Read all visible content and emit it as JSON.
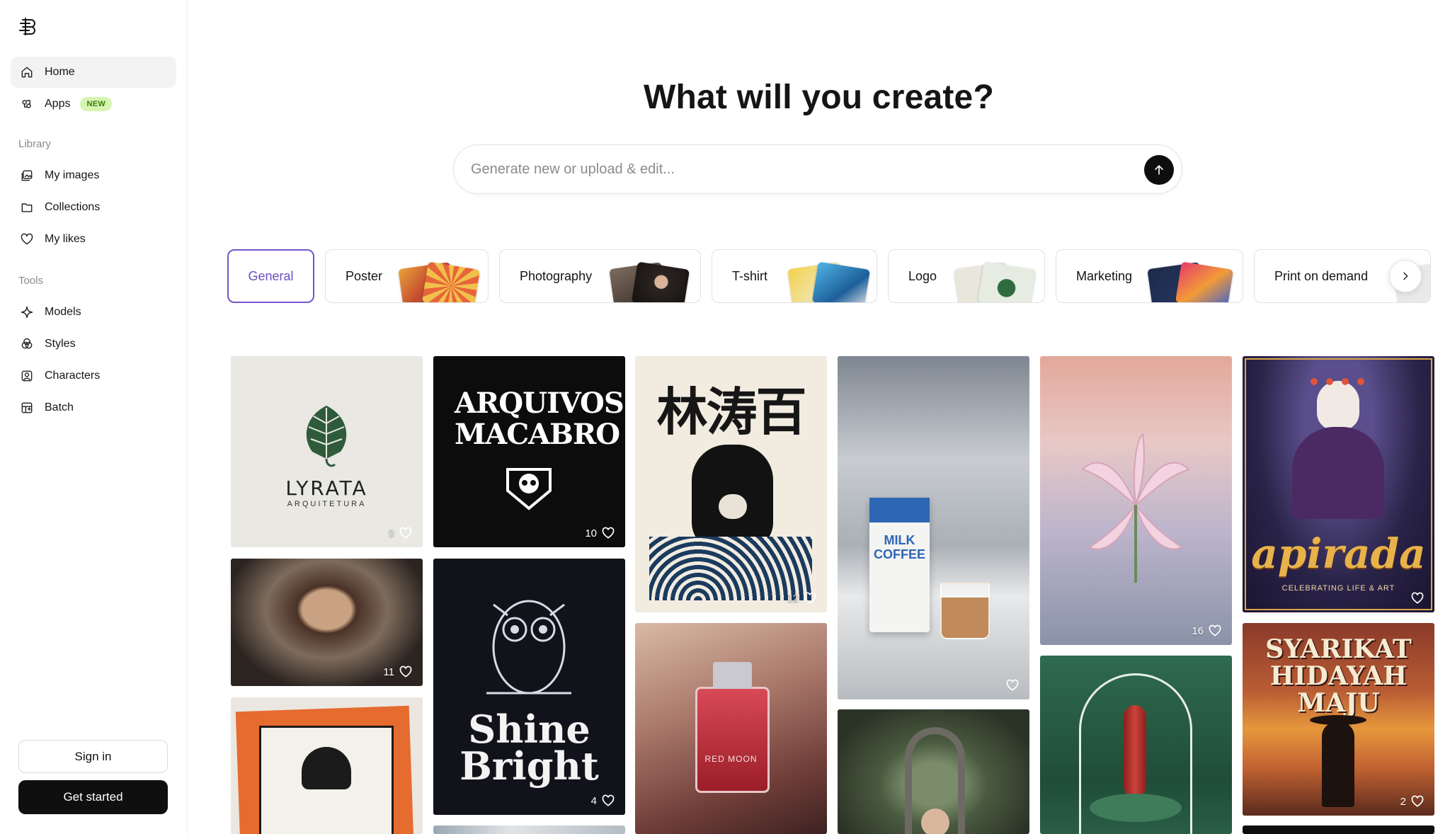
{
  "sidebar": {
    "nav": [
      {
        "label": "Home",
        "icon": "home-icon"
      },
      {
        "label": "Apps",
        "icon": "apps-icon",
        "badge": "NEW"
      }
    ],
    "library_label": "Library",
    "library": [
      {
        "label": "My images",
        "icon": "images-icon"
      },
      {
        "label": "Collections",
        "icon": "folder-icon"
      },
      {
        "label": "My likes",
        "icon": "heart-icon"
      }
    ],
    "tools_label": "Tools",
    "tools": [
      {
        "label": "Models",
        "icon": "sparkle-icon"
      },
      {
        "label": "Styles",
        "icon": "styles-icon"
      },
      {
        "label": "Characters",
        "icon": "characters-icon"
      },
      {
        "label": "Batch",
        "icon": "batch-icon"
      }
    ],
    "sign_in": "Sign in",
    "get_started": "Get started"
  },
  "main": {
    "title": "What will you create?",
    "search_placeholder": "Generate new or upload & edit...",
    "categories": [
      "General",
      "Poster",
      "Photography",
      "T-shirt",
      "Logo",
      "Marketing",
      "Print on demand"
    ],
    "active_category": "General",
    "accent_color": "#7356c9"
  },
  "gallery": [
    {
      "name": "lyrata-logo",
      "likes": "9",
      "text": "LYRATA",
      "subtext": "ARQUITETURA"
    },
    {
      "name": "arquivos-macabro",
      "likes": "10",
      "text": "ARQUIVOS MACABRO"
    },
    {
      "name": "cat-wave-print",
      "likes": "12",
      "text": "林涛百"
    },
    {
      "name": "milk-coffee",
      "likes": "",
      "text": "MILK COFFEE"
    },
    {
      "name": "pink-lilies",
      "likes": "16"
    },
    {
      "name": "apirada-poster",
      "likes": "",
      "text": "apirada",
      "subtext": "CELEBRATING LIFE & ART"
    },
    {
      "name": "young-man-portrait",
      "likes": "11"
    },
    {
      "name": "shine-bright-owl",
      "likes": "4",
      "text": "Shine Bright"
    },
    {
      "name": "red-moon-perfume",
      "likes": "",
      "text": "RED MOON"
    },
    {
      "name": "girl-in-garden",
      "likes": ""
    },
    {
      "name": "sausage-product",
      "likes": ""
    },
    {
      "name": "syarikat-hidayah-maju",
      "likes": "2",
      "text": "SYARIKAT HIDAYAH MAJU"
    },
    {
      "name": "cassette-illustration",
      "likes": ""
    },
    {
      "name": "window-photo",
      "likes": ""
    },
    {
      "name": "dark-tile",
      "likes": ""
    }
  ]
}
